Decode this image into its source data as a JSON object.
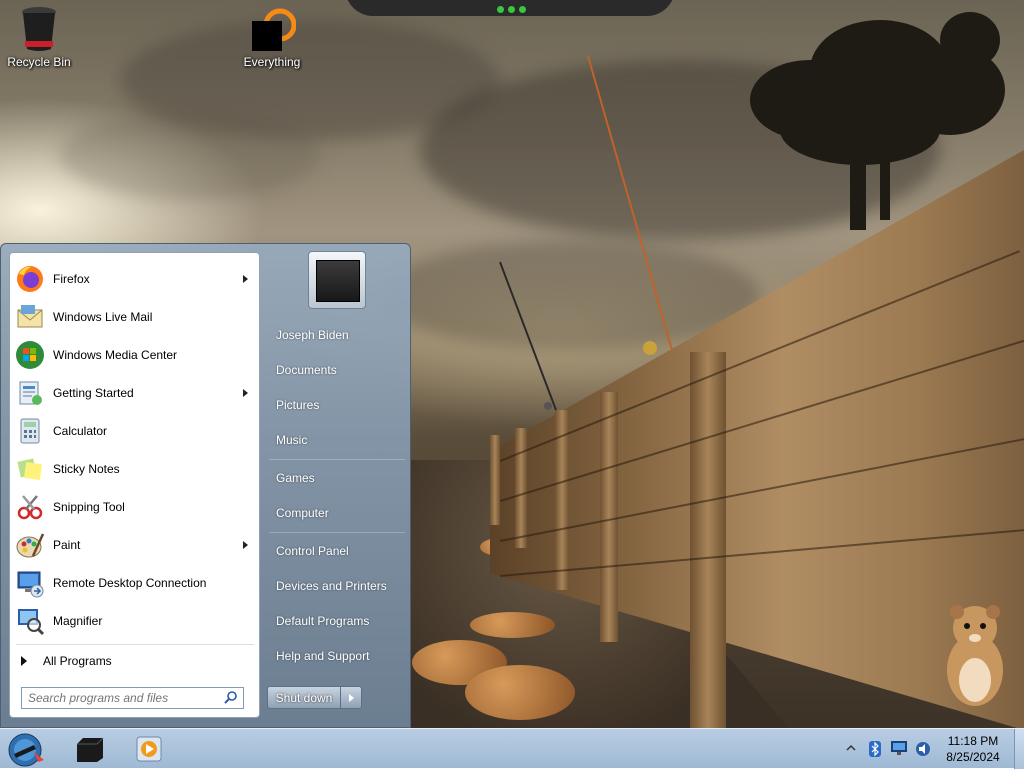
{
  "desktop": {
    "icons": [
      {
        "label": "Recycle Bin",
        "icon": "recycle-bin-icon"
      },
      {
        "label": "Everything",
        "icon": "everything-search-icon"
      }
    ]
  },
  "start_menu": {
    "programs": [
      {
        "label": "Firefox",
        "icon": "firefox-icon",
        "has_submenu": true
      },
      {
        "label": "Windows Live Mail",
        "icon": "mail-icon",
        "has_submenu": false
      },
      {
        "label": "Windows Media Center",
        "icon": "windows-logo-icon",
        "has_submenu": false
      },
      {
        "label": "Getting Started",
        "icon": "getting-started-icon",
        "has_submenu": true
      },
      {
        "label": "Calculator",
        "icon": "calculator-icon",
        "has_submenu": false
      },
      {
        "label": "Sticky Notes",
        "icon": "sticky-notes-icon",
        "has_submenu": false
      },
      {
        "label": "Snipping Tool",
        "icon": "scissors-icon",
        "has_submenu": false
      },
      {
        "label": "Paint",
        "icon": "paint-palette-icon",
        "has_submenu": true
      },
      {
        "label": "Remote Desktop Connection",
        "icon": "remote-desktop-icon",
        "has_submenu": false
      },
      {
        "label": "Magnifier",
        "icon": "magnifier-icon",
        "has_submenu": false
      }
    ],
    "all_programs_label": "All Programs",
    "search_placeholder": "Search programs and files",
    "right_links": [
      {
        "label": "Joseph Biden",
        "name": "user-folder"
      },
      {
        "label": "Documents",
        "name": "documents"
      },
      {
        "label": "Pictures",
        "name": "pictures"
      },
      {
        "label": "Music",
        "name": "music"
      },
      {
        "label": "Games",
        "name": "games"
      },
      {
        "label": "Computer",
        "name": "computer"
      },
      {
        "label": "Control Panel",
        "name": "control-panel"
      },
      {
        "label": "Devices and Printers",
        "name": "devices-and-printers"
      },
      {
        "label": "Default Programs",
        "name": "default-programs"
      },
      {
        "label": "Help and Support",
        "name": "help-and-support"
      }
    ],
    "shutdown_label": "Shut down"
  },
  "taskbar": {
    "pinned": [
      {
        "name": "taskbar-app-black-box",
        "icon": "black-box-icon"
      },
      {
        "name": "taskbar-app-media-player",
        "icon": "media-player-icon"
      }
    ],
    "tray_icons": [
      "show-hidden-icons-icon",
      "bluetooth-icon",
      "network-icon",
      "volume-icon"
    ],
    "clock": {
      "time": "11:18 PM",
      "date": "8/25/2024"
    }
  },
  "colors": {
    "accent_start_menu": "#7e93a8",
    "taskbar": "#aec4dc",
    "tray_status_green": "#38c73e"
  }
}
